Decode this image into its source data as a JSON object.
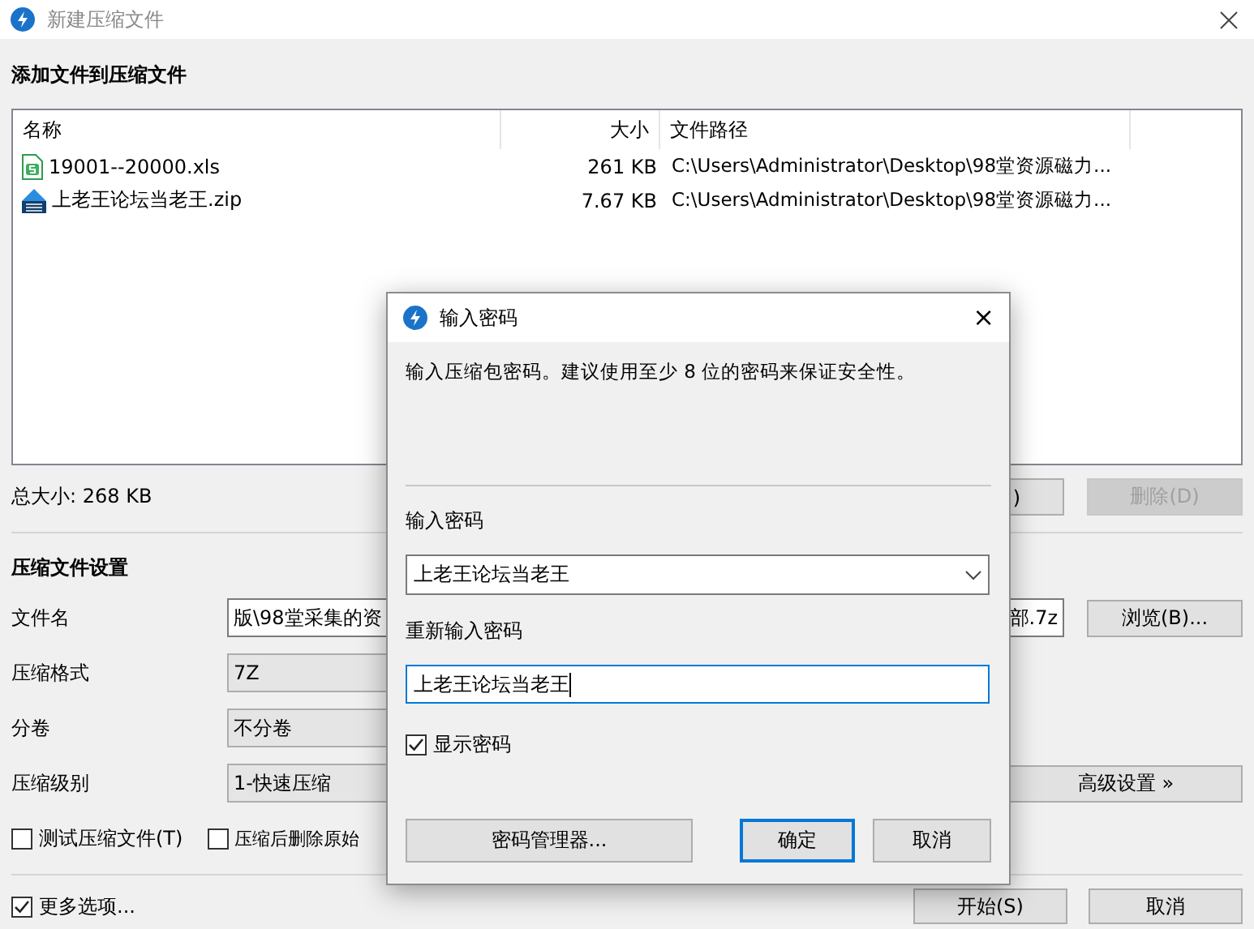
{
  "window": {
    "title": "新建压缩文件"
  },
  "add_section": {
    "heading": "添加文件到压缩文件"
  },
  "file_list": {
    "columns": [
      "名称",
      "大小",
      "文件路径"
    ],
    "rows": [
      {
        "kind": "spreadsheet",
        "name": "19001--20000.xls",
        "size": "261 KB",
        "path": "C:\\Users\\Administrator\\Desktop\\98堂资源磁力..."
      },
      {
        "kind": "archive",
        "name": "上老王论坛当老王.zip",
        "size": "7.67 KB",
        "path": "C:\\Users\\Administrator\\Desktop\\98堂资源磁力..."
      }
    ]
  },
  "total_size": "总大小: 268 KB",
  "list_buttons": [
    {
      "label": ")",
      "disabled": false
    },
    {
      "label": "删除(D)",
      "disabled": true
    }
  ],
  "settings": {
    "heading": "压缩文件设置",
    "filename": {
      "label": "文件名",
      "value_start": "版\\98堂采集的资",
      "value_end": "部.7z"
    },
    "browse_button": "浏览(B)...",
    "format": {
      "label": "压缩格式",
      "value": "7Z"
    },
    "volume": {
      "label": "分卷",
      "value": "不分卷"
    },
    "level": {
      "label": "压缩级别",
      "value": "1-快速压缩"
    },
    "advanced_button": "高级设置 »",
    "options": [
      {
        "label": "测试压缩文件(T)",
        "checked": false
      },
      {
        "label": "压缩后删除原始",
        "checked": false
      }
    ]
  },
  "more_options": {
    "label": "更多选项...",
    "checked": true
  },
  "buttons": [
    "开始(S)",
    "取消"
  ],
  "dialog": {
    "title": "输入密码",
    "close": "×",
    "message": "输入压缩包密码。建议使用至少 8 位的密码来保证安全性。",
    "password_label": "输入密码",
    "password": "上老王论坛当老王",
    "confirm_label": "重新输入密码",
    "confirm": "上老王论坛当老王",
    "show_password": {
      "label": "显示密码",
      "checked": true
    },
    "buttons": [
      {
        "label": "密码管理器...",
        "default": false
      },
      {
        "label": "确定",
        "default": true
      },
      {
        "label": "取消",
        "default": false
      }
    ]
  }
}
